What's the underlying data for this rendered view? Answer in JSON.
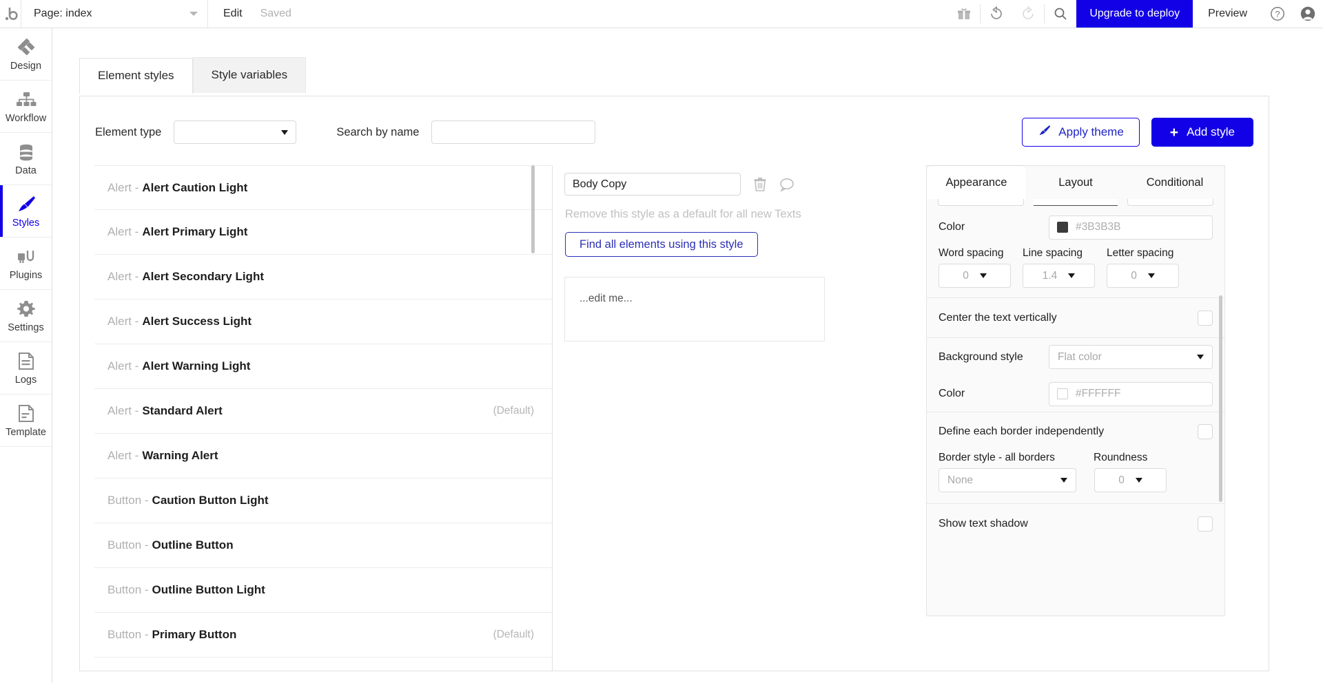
{
  "topbar": {
    "logo": "bubble-logo-icon",
    "page_label": "Page: index",
    "edit_label": "Edit",
    "saved_label": "Saved",
    "gift_icon": "gift-icon",
    "undo_icon": "undo-icon",
    "redo_icon": "redo-icon",
    "search_icon": "search-icon",
    "upgrade_label": "Upgrade to deploy",
    "preview_label": "Preview",
    "help_icon": "help-icon",
    "account_icon": "account-icon",
    "accent_color": "#1200E6"
  },
  "rail": {
    "items": [
      {
        "label": "Design",
        "icon": "design-icon",
        "active": false
      },
      {
        "label": "Workflow",
        "icon": "workflow-icon",
        "active": false
      },
      {
        "label": "Data",
        "icon": "data-icon",
        "active": false
      },
      {
        "label": "Styles",
        "icon": "styles-brush-icon",
        "active": true
      },
      {
        "label": "Plugins",
        "icon": "plugins-icon",
        "active": false
      },
      {
        "label": "Settings",
        "icon": "settings-gear-icon",
        "active": false
      },
      {
        "label": "Logs",
        "icon": "logs-icon",
        "active": false
      },
      {
        "label": "Template",
        "icon": "template-icon",
        "active": false
      }
    ]
  },
  "tabs": [
    {
      "label": "Element styles",
      "active": true
    },
    {
      "label": "Style variables",
      "active": false
    }
  ],
  "filters": {
    "element_type_label": "Element type",
    "element_type_value": "",
    "search_label": "Search by name",
    "search_value": "",
    "search_placeholder": "",
    "apply_theme_label": "Apply theme",
    "apply_theme_icon": "brush-icon",
    "add_style_label": "Add style",
    "add_style_icon": "plus-icon"
  },
  "style_list": {
    "default_badge": "(Default)",
    "rows": [
      {
        "prefix": "Alert -",
        "name": "Alert Caution Light",
        "default": false
      },
      {
        "prefix": "Alert -",
        "name": "Alert Primary Light",
        "default": false
      },
      {
        "prefix": "Alert -",
        "name": "Alert Secondary Light",
        "default": false
      },
      {
        "prefix": "Alert -",
        "name": "Alert Success Light",
        "default": false
      },
      {
        "prefix": "Alert -",
        "name": "Alert Warning Light",
        "default": false
      },
      {
        "prefix": "Alert -",
        "name": "Standard Alert",
        "default": true
      },
      {
        "prefix": "Alert -",
        "name": "Warning Alert",
        "default": false
      },
      {
        "prefix": "Button -",
        "name": "Caution Button Light",
        "default": false
      },
      {
        "prefix": "Button -",
        "name": "Outline Button",
        "default": false
      },
      {
        "prefix": "Button -",
        "name": "Outline Button Light",
        "default": false
      },
      {
        "prefix": "Button -",
        "name": "Primary Button",
        "default": true
      }
    ]
  },
  "detail": {
    "style_name": "Body Copy",
    "delete_icon": "trash-icon",
    "comment_icon": "comment-icon",
    "remove_default_text": "Remove this style as a default for all new Texts",
    "find_button_label": "Find all elements using this style",
    "preview_text": "...edit me..."
  },
  "props": {
    "tabs": [
      {
        "label": "Appearance",
        "active": true
      },
      {
        "label": "Layout",
        "active": false
      },
      {
        "label": "Conditional",
        "active": false
      }
    ],
    "color_label": "Color",
    "color_value": "#3B3B3B",
    "color_swatch": "#3B3B3B",
    "word_spacing_label": "Word spacing",
    "word_spacing_value": "0",
    "line_spacing_label": "Line spacing",
    "line_spacing_value": "1.4",
    "letter_spacing_label": "Letter spacing",
    "letter_spacing_value": "0",
    "center_text_label": "Center the text vertically",
    "center_text_checked": false,
    "background_style_label": "Background style",
    "background_style_value": "Flat color",
    "background_color_label": "Color",
    "background_color_value": "#FFFFFF",
    "background_color_swatch": "#FFFFFF",
    "define_borders_label": "Define each border independently",
    "define_borders_checked": false,
    "border_style_label": "Border style - all borders",
    "border_style_value": "None",
    "roundness_label": "Roundness",
    "roundness_value": "0",
    "text_shadow_label": "Show text shadow",
    "text_shadow_checked": false
  }
}
